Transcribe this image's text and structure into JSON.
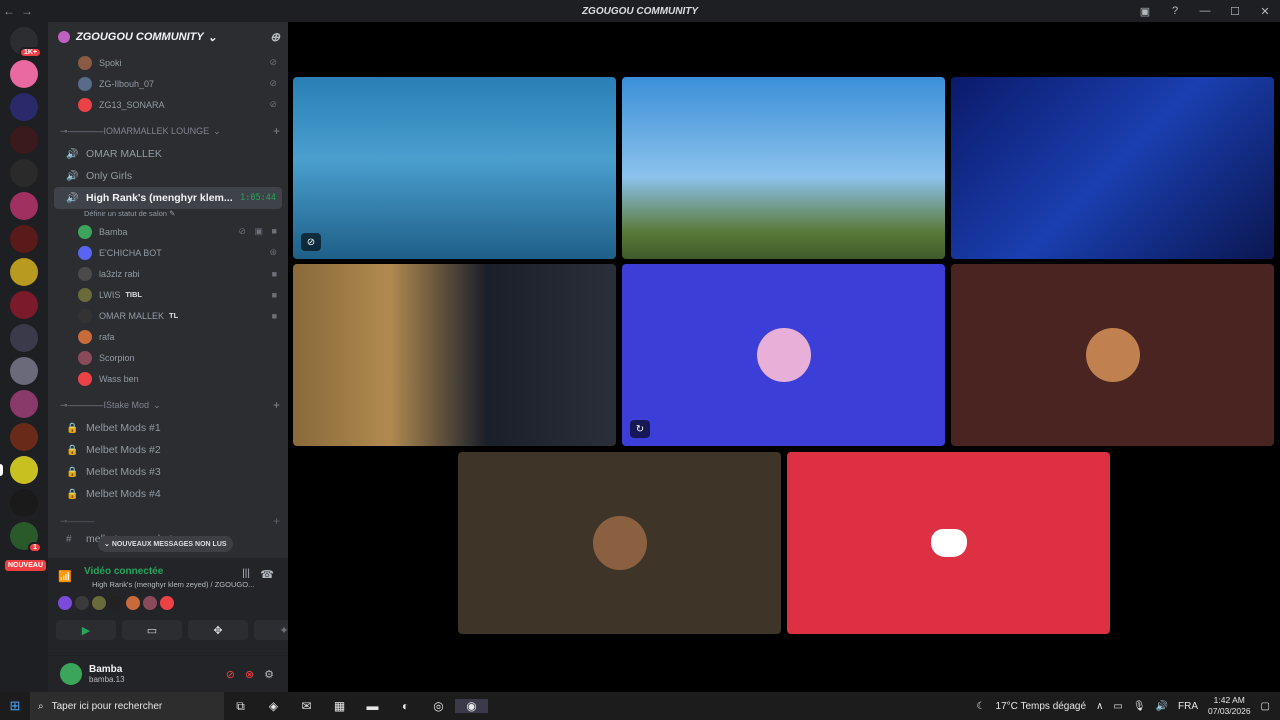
{
  "window": {
    "title": "ZGOUGOU COMMUNITY"
  },
  "guilds": {
    "top_badge": "1K+",
    "badge2": "1",
    "new_badge": "NOUVEAU"
  },
  "server": {
    "name": "ZGOUGOU COMMUNITY"
  },
  "top_users": [
    {
      "name": "Spoki",
      "color": "#8a5a44"
    },
    {
      "name": "ZG-Ilbouh_07",
      "color": "#5a6a8a"
    },
    {
      "name": "ZG13_SONARA",
      "color": "#ed4245"
    }
  ],
  "category1": {
    "label": "⊸————IOMARMALLEK LOUNGE"
  },
  "channels1": [
    {
      "name": "OMAR MALLEK"
    },
    {
      "name": "Only Girls"
    },
    {
      "name": "High Rank's (menghyr klem...",
      "time": "1:05:44",
      "status_hint": "Définir un statut de salon"
    }
  ],
  "voice_users": [
    {
      "name": "Bamba",
      "color": "#3ba55c",
      "icons": "⊘ ▣ ■"
    },
    {
      "name": "E'CHICHA BOT",
      "color": "#5865f2",
      "icons": "⊛"
    },
    {
      "name": "la3zlz rabi",
      "color": "#4a4a4a",
      "icons": "■"
    },
    {
      "name": "LWIS",
      "color": "#6a6a3a",
      "tag": "TIBL",
      "icons": "■"
    },
    {
      "name": "OMAR MALLEK",
      "color": "#333333",
      "tag": "TL",
      "icons": "■"
    },
    {
      "name": "rafa",
      "color": "#c86a3a",
      "icons": ""
    },
    {
      "name": "Scorpion",
      "color": "#8a4a5a",
      "icons": ""
    },
    {
      "name": "Wass ben",
      "color": "#ed4245",
      "icons": ""
    }
  ],
  "category2": {
    "label": "⊸————IStake Mod"
  },
  "channels2": [
    {
      "name": "Melbet Mods #1"
    },
    {
      "name": "Melbet Mods #2"
    },
    {
      "name": "Melbet Mods #3"
    },
    {
      "name": "Melbet Mods #4"
    }
  ],
  "partial_channel": "melbet-screenshots",
  "new_messages": "NOUVEAUX MESSAGES NON LUS",
  "voice": {
    "status": "Vidéo connectée",
    "channel": "High Rank's (menghyr klem zeyed) / ZGOUGO..."
  },
  "user": {
    "name": "Bamba",
    "tag": "bamba.13"
  },
  "video_tiles": [
    {
      "kind": "camera",
      "bg": "linear-gradient(180deg,#2a7fb5 0%,#4a9fcf 45%,#1e5f88 100%)"
    },
    {
      "kind": "camera",
      "bg": "linear-gradient(180deg,#3b8fd8 0%,#8cc2ec 55%,#5a7a3a 85%,#3e5a2a 100%)"
    },
    {
      "kind": "camera",
      "bg": "linear-gradient(135deg,#0b1a6a 0%,#1a3fb0 50%,#0a1650 100%)"
    },
    {
      "kind": "camera",
      "bg": "linear-gradient(90deg,#8a6a3a 0%,#b08a50 30%,#1a1f2a 60%,#2a2f3a 100%)"
    },
    {
      "kind": "avatar",
      "bg": "#3b3fd8",
      "avatar": "#e8b0d8"
    },
    {
      "kind": "avatar",
      "bg": "#4a2420",
      "avatar": "#c08050"
    },
    {
      "kind": "avatar",
      "bg": "#3e3428",
      "avatar": "#8a6040"
    },
    {
      "kind": "logo",
      "bg": "#de3043"
    }
  ],
  "taskbar": {
    "search_placeholder": "Taper ici pour rechercher",
    "weather": "17°C  Temps dégagé",
    "lang": "FRA",
    "time": "1:42 AM",
    "date": "07/03/2026"
  }
}
